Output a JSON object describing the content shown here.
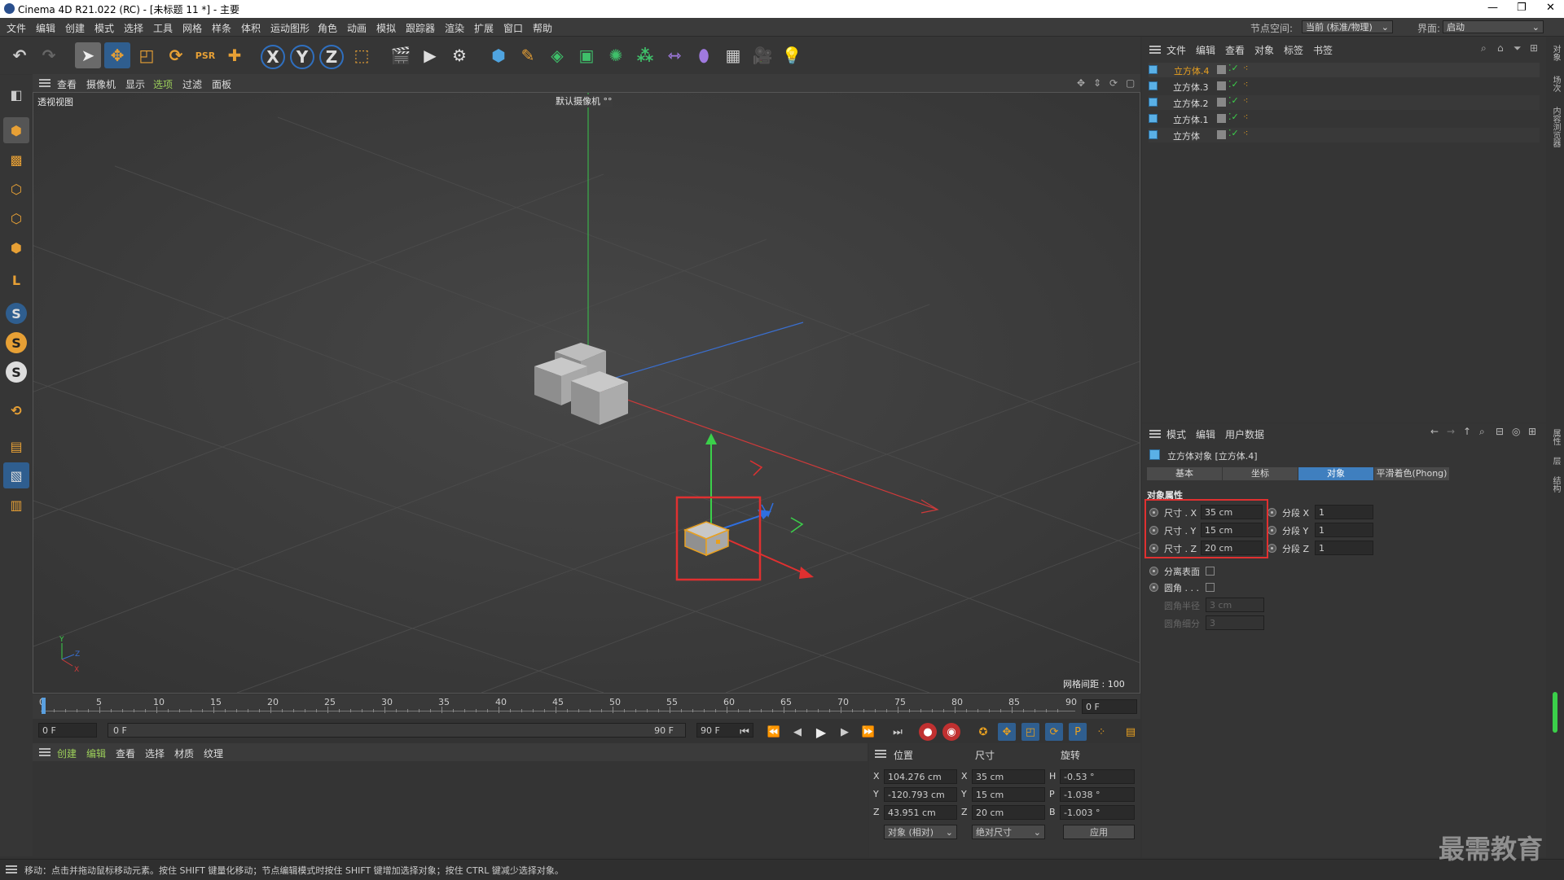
{
  "window": {
    "title": "Cinema 4D R21.022 (RC) - [未标题 11 *] - 主要"
  },
  "menubar": {
    "items": [
      "文件",
      "编辑",
      "创建",
      "模式",
      "选择",
      "工具",
      "网格",
      "样条",
      "体积",
      "运动图形",
      "角色",
      "动画",
      "模拟",
      "跟踪器",
      "渲染",
      "扩展",
      "窗口",
      "帮助"
    ],
    "node_space_label": "节点空间:",
    "node_space_value": "当前 (标准/物理)",
    "interface_label": "界面:",
    "interface_value": "启动"
  },
  "viewport": {
    "menu": [
      "查看",
      "摄像机",
      "显示",
      "选项",
      "过滤",
      "面板"
    ],
    "view_name": "透视视图",
    "camera_label": "默认摄像机 °°",
    "grid_spacing": "网格间距 : 100 cm"
  },
  "timeline": {
    "ticks": [
      "0",
      "5",
      "10",
      "15",
      "20",
      "25",
      "30",
      "35",
      "40",
      "45",
      "50",
      "55",
      "60",
      "65",
      "70",
      "75",
      "80",
      "85",
      "90"
    ],
    "current_frame": "0 F",
    "start_frame": "0 F",
    "range_start": "0 F",
    "range_end": "90 F",
    "end_frame": "90 F"
  },
  "material_manager": {
    "menu": [
      "创建",
      "编辑",
      "查看",
      "选择",
      "材质",
      "纹理"
    ]
  },
  "coordinates": {
    "headers": {
      "position": "位置",
      "size": "尺寸",
      "rotation": "旋转"
    },
    "rows": [
      {
        "axis": "X",
        "pos": "104.276 cm",
        "size_axis": "X",
        "size": "35 cm",
        "rot_axis": "H",
        "rot": "-0.53 °"
      },
      {
        "axis": "Y",
        "pos": "-120.793 cm",
        "size_axis": "Y",
        "size": "15 cm",
        "rot_axis": "P",
        "rot": "-1.038 °"
      },
      {
        "axis": "Z",
        "pos": "43.951 cm",
        "size_axis": "Z",
        "size": "20 cm",
        "rot_axis": "B",
        "rot": "-1.003 °"
      }
    ],
    "mode_select": "对象 (相对)",
    "size_select": "绝对尺寸",
    "apply_button": "应用"
  },
  "object_manager": {
    "menu": [
      "文件",
      "编辑",
      "查看",
      "对象",
      "标签",
      "书签"
    ],
    "objects": [
      {
        "name": "立方体.4",
        "selected": true
      },
      {
        "name": "立方体.3",
        "selected": false
      },
      {
        "name": "立方体.2",
        "selected": false
      },
      {
        "name": "立方体.1",
        "selected": false
      },
      {
        "name": "立方体",
        "selected": false
      }
    ]
  },
  "attribute_manager": {
    "menu": [
      "模式",
      "编辑",
      "用户数据"
    ],
    "object_title": "立方体对象 [立方体.4]",
    "tabs": [
      "基本",
      "坐标",
      "对象",
      "平滑着色(Phong)"
    ],
    "active_tab": "对象",
    "section_title": "对象属性",
    "size_fields": [
      {
        "label": "尺寸 . X",
        "value": "35 cm"
      },
      {
        "label": "尺寸 . Y",
        "value": "15 cm"
      },
      {
        "label": "尺寸 . Z",
        "value": "20 cm"
      }
    ],
    "segment_fields": [
      {
        "label": "分段 X",
        "value": "1"
      },
      {
        "label": "分段 Y",
        "value": "1"
      },
      {
        "label": "分段 Z",
        "value": "1"
      }
    ],
    "separate_surfaces": "分离表面",
    "fillet": "圆角 . . .",
    "fillet_radius_label": "圆角半径",
    "fillet_radius_value": "3 cm",
    "fillet_subdiv_label": "圆角细分",
    "fillet_subdiv_value": "3"
  },
  "right_strip": [
    "对象",
    "场次",
    "内容浏览器",
    "属性",
    "层",
    "结构"
  ],
  "status_bar": {
    "text": "移动：点击并拖动鼠标移动元素。按住 SHIFT 键量化移动；节点编辑模式时按住 SHIFT 键增加选择对象；按住 CTRL 键减少选择对象。"
  },
  "watermark": "最需教育",
  "colors": {
    "accent_blue": "#3f7fbf",
    "highlight_red": "#e03030",
    "selected_orange": "#e8a020"
  }
}
